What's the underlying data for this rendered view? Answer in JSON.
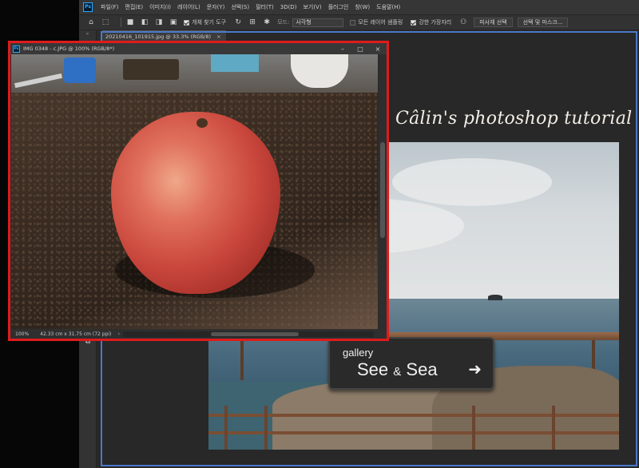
{
  "menubar": {
    "logo": "Ps",
    "items": [
      "파일(F)",
      "편집(E)",
      "이미지(I)",
      "레이어(L)",
      "문자(Y)",
      "선택(S)",
      "필터(T)",
      "3D(D)",
      "보기(V)",
      "플러그인",
      "창(W)",
      "도움말(H)"
    ]
  },
  "options": {
    "home_icon": "home-icon",
    "auto_select_label": "개체 찾기 도구",
    "mode_label": "모드:",
    "mode_value": "사각형",
    "sample_all_label": "모든 레이어 샘플링",
    "hard_edge_label": "강한 가장자리",
    "select_subject_label": "피사체 선택",
    "select_mask_label": "선택 및 마스크..."
  },
  "tab": {
    "label": "20210416_101915.jpg @ 33.3% (RGB/8)",
    "close": "×"
  },
  "toolbar": {
    "collapse": "»"
  },
  "canvas": {
    "title": "Câlin's photoshop tutorial",
    "sign_small": "gallery",
    "sign_big_1": "See",
    "sign_amp": "&",
    "sign_big_2": "Sea",
    "sign_arrow": "➜"
  },
  "floating_window": {
    "logo": "Ps",
    "title": "IMG 0348 - c.JPG @ 100% (RGB/8*)",
    "minimize": "–",
    "maximize": "□",
    "close": "×",
    "zoom": "100%",
    "doc_info": "42.33 cm x 31.75 cm (72 ppi)",
    "arrow": "›"
  },
  "colors": {
    "highlight_red": "#e01b1b",
    "highlight_blue": "#4a78c9",
    "ps_blue": "#31a8ff"
  }
}
